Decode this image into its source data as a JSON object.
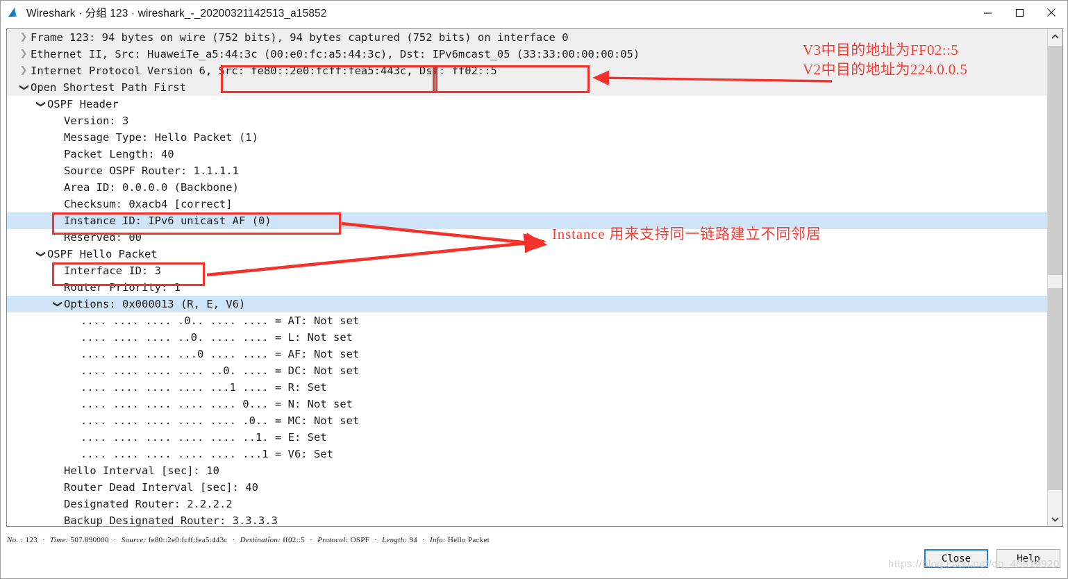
{
  "window": {
    "title": "Wireshark · 分组 123 · wireshark_-_20200321142513_a15852",
    "icon": "wireshark-fin-icon",
    "controls": {
      "minimize": "minimize-icon",
      "maximize": "maximize-icon",
      "close": "close-icon"
    }
  },
  "colors": {
    "annotation_red": "#ff3b35",
    "box_red": "#f5312b",
    "selected_row": "#cfe4f7",
    "header_row": "#efefef",
    "default_button_border": "#1e7fd4"
  },
  "tree": [
    {
      "indent": 0,
      "state": "closed",
      "text": "Frame 123: 94 bytes on wire (752 bits), 94 bytes captured (752 bits) on interface 0",
      "bg": "gray"
    },
    {
      "indent": 0,
      "state": "closed",
      "text": "Ethernet II, Src: HuaweiTe_a5:44:3c (00:e0:fc:a5:44:3c), Dst: IPv6mcast_05 (33:33:00:00:00:05)",
      "bg": "gray"
    },
    {
      "indent": 0,
      "state": "closed",
      "text": "Internet Protocol Version 6, Src: fe80::2e0:fcff:fea5:443c, Dst: ff02::5",
      "bg": "gray"
    },
    {
      "indent": 0,
      "state": "open",
      "text": "Open Shortest Path First",
      "bg": "gray"
    },
    {
      "indent": 1,
      "state": "open",
      "text": "OSPF Header",
      "bg": "none"
    },
    {
      "indent": 2,
      "state": "leaf",
      "text": "Version: 3",
      "bg": "none"
    },
    {
      "indent": 2,
      "state": "leaf",
      "text": "Message Type: Hello Packet (1)",
      "bg": "none"
    },
    {
      "indent": 2,
      "state": "leaf",
      "text": "Packet Length: 40",
      "bg": "none"
    },
    {
      "indent": 2,
      "state": "leaf",
      "text": "Source OSPF Router: 1.1.1.1",
      "bg": "none"
    },
    {
      "indent": 2,
      "state": "leaf",
      "text": "Area ID: 0.0.0.0 (Backbone)",
      "bg": "none"
    },
    {
      "indent": 2,
      "state": "leaf",
      "text": "Checksum: 0xacb4 [correct]",
      "bg": "none"
    },
    {
      "indent": 2,
      "state": "leaf",
      "text": "Instance ID: IPv6 unicast AF (0)",
      "bg": "sel"
    },
    {
      "indent": 2,
      "state": "leaf",
      "text": "Reserved: 00",
      "bg": "none"
    },
    {
      "indent": 1,
      "state": "open",
      "text": "OSPF Hello Packet",
      "bg": "none"
    },
    {
      "indent": 2,
      "state": "leaf",
      "text": "Interface ID: 3",
      "bg": "none"
    },
    {
      "indent": 2,
      "state": "leaf",
      "text": "Router Priority: 1",
      "bg": "none"
    },
    {
      "indent": 2,
      "state": "open",
      "text": "Options: 0x000013 (R, E, V6)",
      "bg": "sel"
    },
    {
      "indent": 3,
      "state": "leaf",
      "text": ".... .... .... .0.. .... .... = AT: Not set",
      "bg": "none"
    },
    {
      "indent": 3,
      "state": "leaf",
      "text": ".... .... .... ..0. .... .... = L: Not set",
      "bg": "none"
    },
    {
      "indent": 3,
      "state": "leaf",
      "text": ".... .... .... ...0 .... .... = AF: Not set",
      "bg": "none"
    },
    {
      "indent": 3,
      "state": "leaf",
      "text": ".... .... .... .... ..0. .... = DC: Not set",
      "bg": "none"
    },
    {
      "indent": 3,
      "state": "leaf",
      "text": ".... .... .... .... ...1 .... = R: Set",
      "bg": "none"
    },
    {
      "indent": 3,
      "state": "leaf",
      "text": ".... .... .... .... .... 0... = N: Not set",
      "bg": "none"
    },
    {
      "indent": 3,
      "state": "leaf",
      "text": ".... .... .... .... .... .0.. = MC: Not set",
      "bg": "none"
    },
    {
      "indent": 3,
      "state": "leaf",
      "text": ".... .... .... .... .... ..1. = E: Set",
      "bg": "none"
    },
    {
      "indent": 3,
      "state": "leaf",
      "text": ".... .... .... .... .... ...1 = V6: Set",
      "bg": "none"
    },
    {
      "indent": 2,
      "state": "leaf",
      "text": "Hello Interval [sec]: 10",
      "bg": "none"
    },
    {
      "indent": 2,
      "state": "leaf",
      "text": "Router Dead Interval [sec]: 40",
      "bg": "none"
    },
    {
      "indent": 2,
      "state": "leaf",
      "text": "Designated Router: 2.2.2.2",
      "bg": "none"
    },
    {
      "indent": 2,
      "state": "leaf",
      "text": "Backup Designated Router: 3.3.3.3",
      "bg": "none"
    }
  ],
  "annotations": {
    "ipv6_dest_line1": "V3中目的地址为FF02::5",
    "ipv6_dest_line2": "V2中目的地址为224.0.0.5",
    "instance_note": "Instance 用来支持同一链路建立不同邻居"
  },
  "status": {
    "fields": [
      {
        "label": "No. :",
        "value": "123"
      },
      {
        "label": "Time:",
        "value": "507.890000"
      },
      {
        "label": "Source:",
        "value": "fe80::2e0:fcff:fea5:443c"
      },
      {
        "label": "Destination:",
        "value": "ff02::5"
      },
      {
        "label": "Protocol:",
        "value": "OSPF"
      },
      {
        "label": "Length:",
        "value": "94"
      },
      {
        "label": "Info:",
        "value": "Hello Packet"
      }
    ],
    "separator": "·"
  },
  "buttons": {
    "close": "Close",
    "help": "Help"
  },
  "watermark": "https://blog.csdn.net/qq_45519920"
}
